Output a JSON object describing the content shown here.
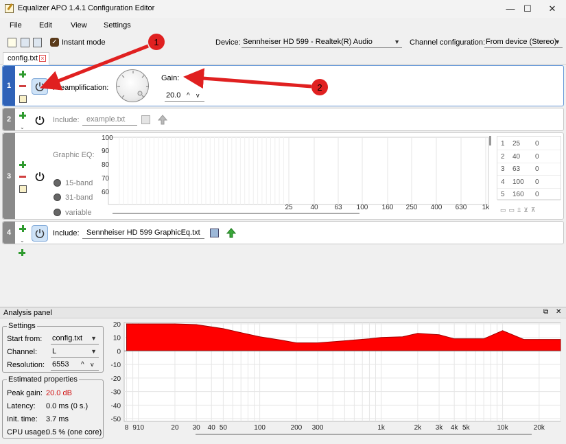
{
  "window": {
    "title": "Equalizer APO 1.4.1 Configuration Editor",
    "minimize_glyph": "—",
    "maximize_glyph": "☐",
    "close_glyph": "✕"
  },
  "menu": {
    "file": "File",
    "edit": "Edit",
    "view": "View",
    "settings": "Settings"
  },
  "toolbar": {
    "instant_mode": "Instant mode",
    "instant_mode_checked": true,
    "device_label": "Device:",
    "device_value": "Sennheiser HD 599 - Realtek(R) Audio",
    "channel_config_label": "Channel configuration:",
    "channel_config_value": "From device (Stereo)"
  },
  "tab": {
    "name": "config.txt",
    "close_glyph": "×"
  },
  "rows": {
    "r1": {
      "number": "1",
      "preamp_label": "Preamplification:",
      "gain_label": "Gain:",
      "gain_value": "20.0",
      "up_glyph": "^",
      "down_glyph": "v"
    },
    "r2": {
      "number": "2",
      "include_label": "Include:",
      "include_value": "example.txt"
    },
    "r3": {
      "number": "3",
      "graphic_eq_label": "Graphic EQ:",
      "band15": "15-band",
      "band31": "31-band",
      "variable": "variable",
      "y_ticks": [
        "100",
        "90",
        "80",
        "70",
        "60"
      ],
      "x_ticks": [
        "25",
        "40",
        "63",
        "100",
        "160",
        "250",
        "400",
        "630",
        "1k"
      ],
      "table": [
        [
          "1",
          "25",
          "0"
        ],
        [
          "2",
          "40",
          "0"
        ],
        [
          "3",
          "63",
          "0"
        ],
        [
          "4",
          "100",
          "0"
        ],
        [
          "5",
          "160",
          "0"
        ]
      ]
    },
    "r4": {
      "number": "4",
      "include_label": "Include:",
      "include_value": "Sennheiser HD 599 GraphicEq.txt"
    }
  },
  "annotations": {
    "a1": "1",
    "a2": "2",
    "accent": "#e02020"
  },
  "analysis": {
    "title": "Analysis panel",
    "restore_glyph": "⧉",
    "close_glyph": "✕",
    "settings_group": "Settings",
    "start_from_label": "Start from:",
    "start_from_value": "config.txt",
    "channel_label": "Channel:",
    "channel_value": "L",
    "resolution_label": "Resolution:",
    "resolution_value": "6553",
    "estimated_group": "Estimated properties",
    "peak_gain_label": "Peak gain:",
    "peak_gain_value": "20.0 dB",
    "latency_label": "Latency:",
    "latency_value": "0.0 ms (0 s.)",
    "init_time_label": "Init. time:",
    "init_time_value": "3.7 ms",
    "cpu_label": "CPU usage:",
    "cpu_value": "0.5 % (one core)",
    "peak_color": "#d01010",
    "response_color": "#ff0000"
  },
  "chart_data": {
    "type": "area",
    "x": [
      8,
      10,
      20,
      30,
      50,
      70,
      100,
      150,
      200,
      300,
      500,
      800,
      1000,
      1500,
      2000,
      3000,
      4000,
      5000,
      7000,
      10000,
      15000,
      20000,
      30000
    ],
    "y": [
      20,
      20,
      20,
      19.5,
      16.5,
      13.5,
      10.5,
      8,
      6,
      6,
      7.5,
      9,
      10,
      10.5,
      13,
      12,
      9,
      9,
      9,
      15,
      8.5,
      8.5,
      8.5
    ],
    "x_tick_labels": [
      "8",
      "910",
      "20",
      "30",
      "40",
      "50",
      "100",
      "200",
      "300",
      "1k",
      "2k",
      "3k",
      "4k",
      "5k",
      "10k",
      "20k"
    ],
    "x_tick_values": [
      8,
      10,
      20,
      30,
      40,
      50,
      100,
      200,
      300,
      1000,
      2000,
      3000,
      4000,
      5000,
      10000,
      20000
    ],
    "y_ticks": [
      20,
      10,
      0,
      -10,
      -20,
      -30,
      -40,
      -50
    ],
    "ylim": [
      -52,
      21
    ],
    "xscale": "log",
    "grid": true
  }
}
